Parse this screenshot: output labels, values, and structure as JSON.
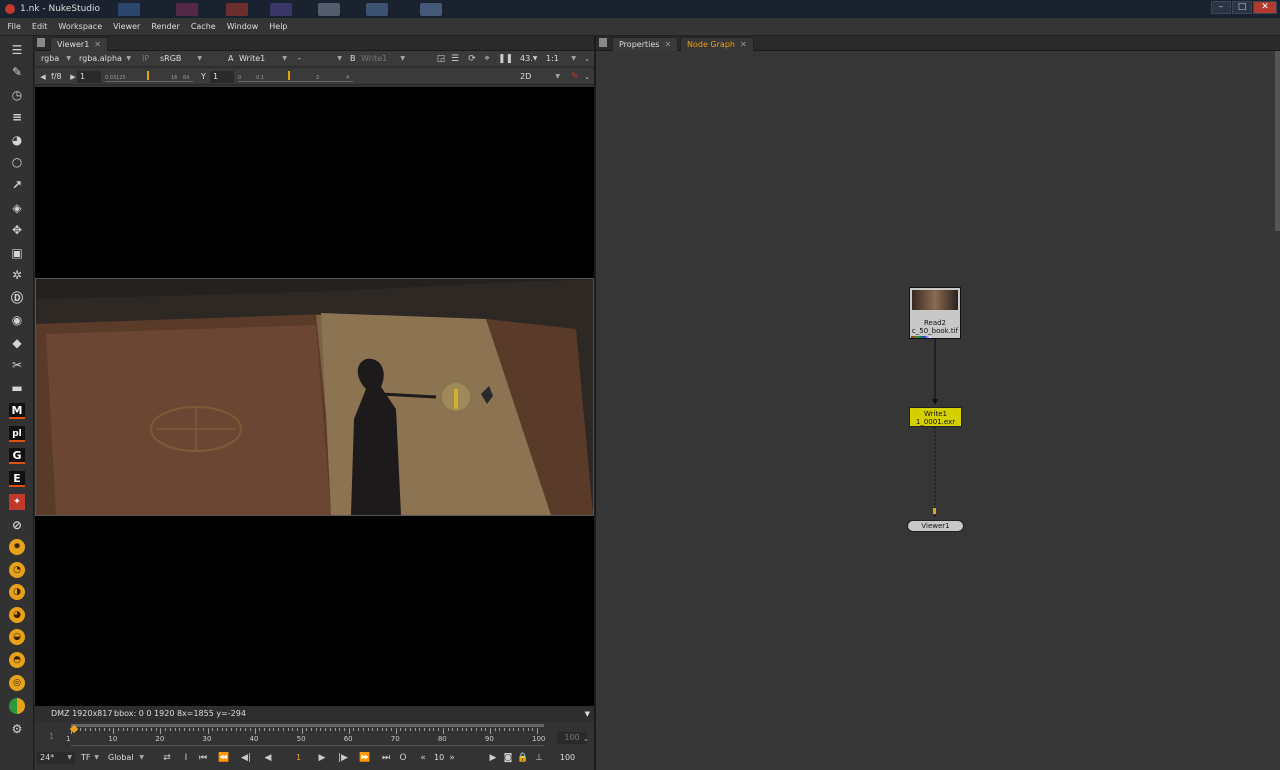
{
  "window": {
    "title": "1.nk - NukeStudio"
  },
  "menu": [
    "File",
    "Edit",
    "Workspace",
    "Viewer",
    "Render",
    "Cache",
    "Window",
    "Help"
  ],
  "viewer": {
    "tab": "Viewer1",
    "channels": "rgba",
    "alpha": "rgba.alpha",
    "ip": "IP",
    "colorspace": "sRGB",
    "a_label": "A",
    "a_input": "Write1",
    "op": "-",
    "b_label": "B",
    "b_input": "Write1",
    "zoom": "43.",
    "ratio": "1:1",
    "fstop": "f/8",
    "gain": "1",
    "gamma_label": "Y",
    "gamma": "1",
    "mode": "2D",
    "gain_ticks": [
      "0.03125",
      "1",
      "16",
      "64"
    ],
    "gamma_ticks": [
      "0",
      "0.1",
      "1",
      "2",
      "4"
    ],
    "status": {
      "format": "DMZ 1920x817",
      "bbox": "bbox: 0 0 1920 8",
      "coords": "x=1855 y=-294"
    },
    "timeline": {
      "start": "1",
      "end": "100",
      "ticks": [
        "1",
        "10",
        "20",
        "30",
        "40",
        "50",
        "60",
        "70",
        "80",
        "90",
        "100"
      ],
      "fps": "24*",
      "tf": "TF",
      "scope": "Global",
      "frame": "1",
      "step": "10",
      "end_field": "100"
    }
  },
  "panel": {
    "tabs": [
      "Properties",
      "Node Graph"
    ],
    "active_tab": "Node Graph",
    "nodes": {
      "read": {
        "name": "Read2",
        "file": "c_50_book.tif"
      },
      "write": {
        "name": "Write1",
        "file": "1_0001.exr"
      },
      "viewer": {
        "name": "Viewer1"
      }
    }
  },
  "colors": {
    "accent": "#e8a21a",
    "write_node": "#d4d000",
    "titlebar": "#1a2230"
  }
}
